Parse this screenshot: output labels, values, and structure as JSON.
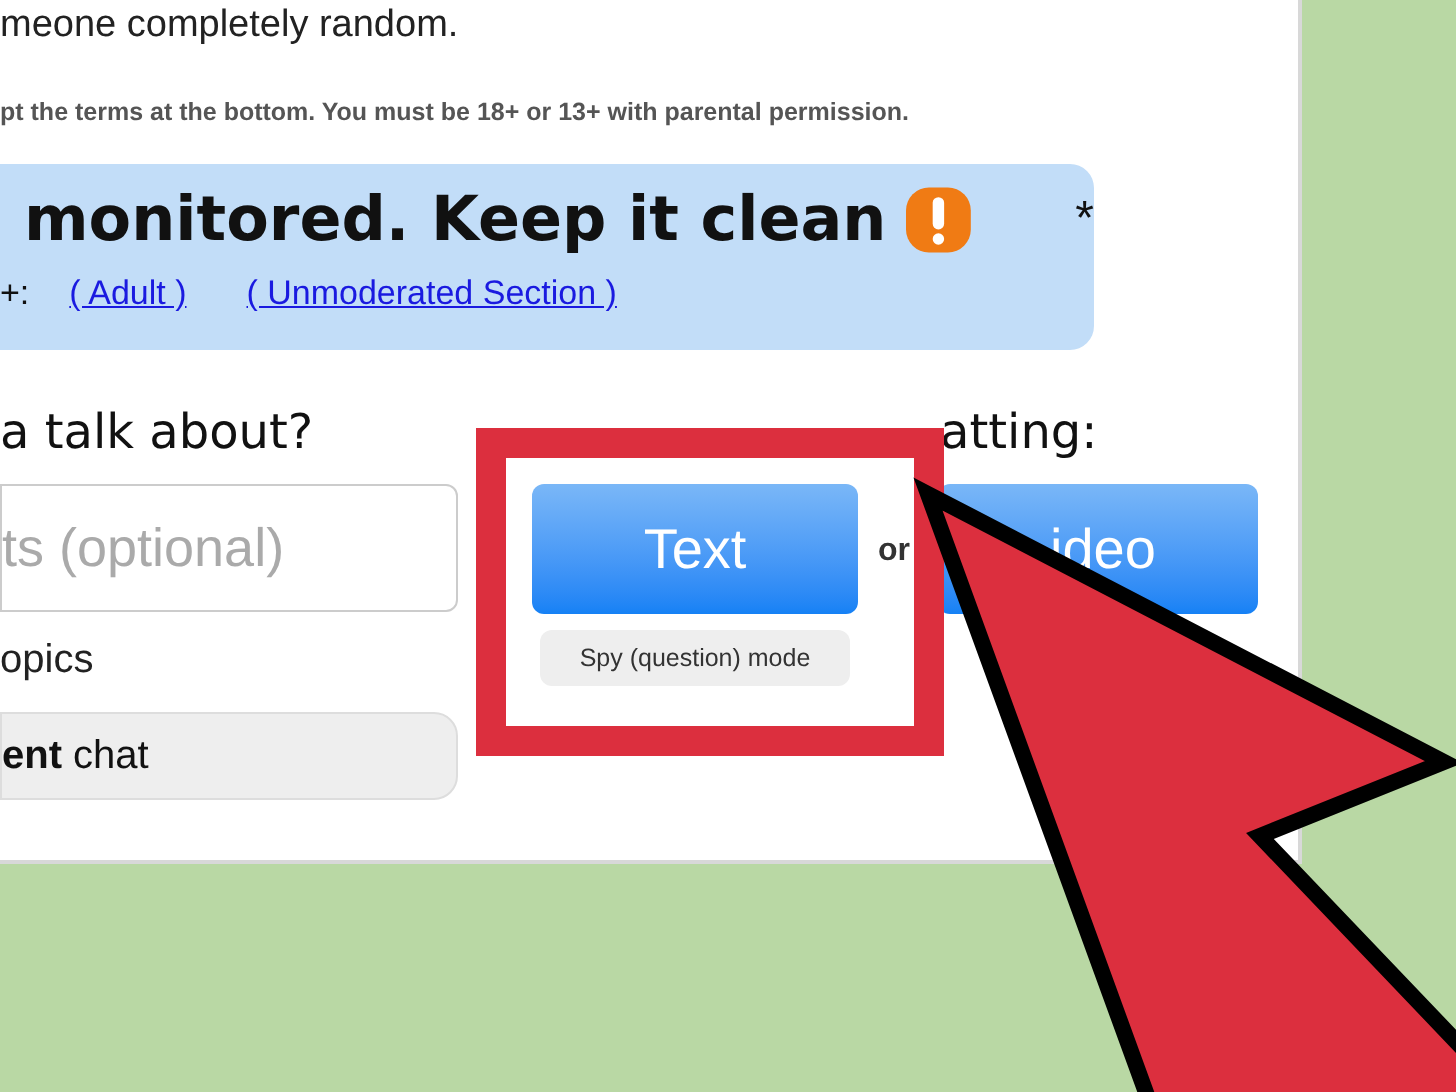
{
  "intro_text": "meone completely random.",
  "terms_notice": "pt the terms at the bottom. You must be 18+ or 13+ with parental permission.",
  "banner": {
    "heading": "monitored. Keep it clean",
    "asterisk": "*",
    "prefix": "+:",
    "links": [
      "( Adult )",
      "( Unmoderated Section )"
    ]
  },
  "topics": {
    "heading": "a talk about?",
    "placeholder": "ts (optional)",
    "label": "opics",
    "button": "**ent** chat"
  },
  "start": {
    "heading": "atting:",
    "text_button": "Text",
    "separator": "or",
    "video_button": "ideo",
    "mode_button": "Spy (question) mode"
  }
}
